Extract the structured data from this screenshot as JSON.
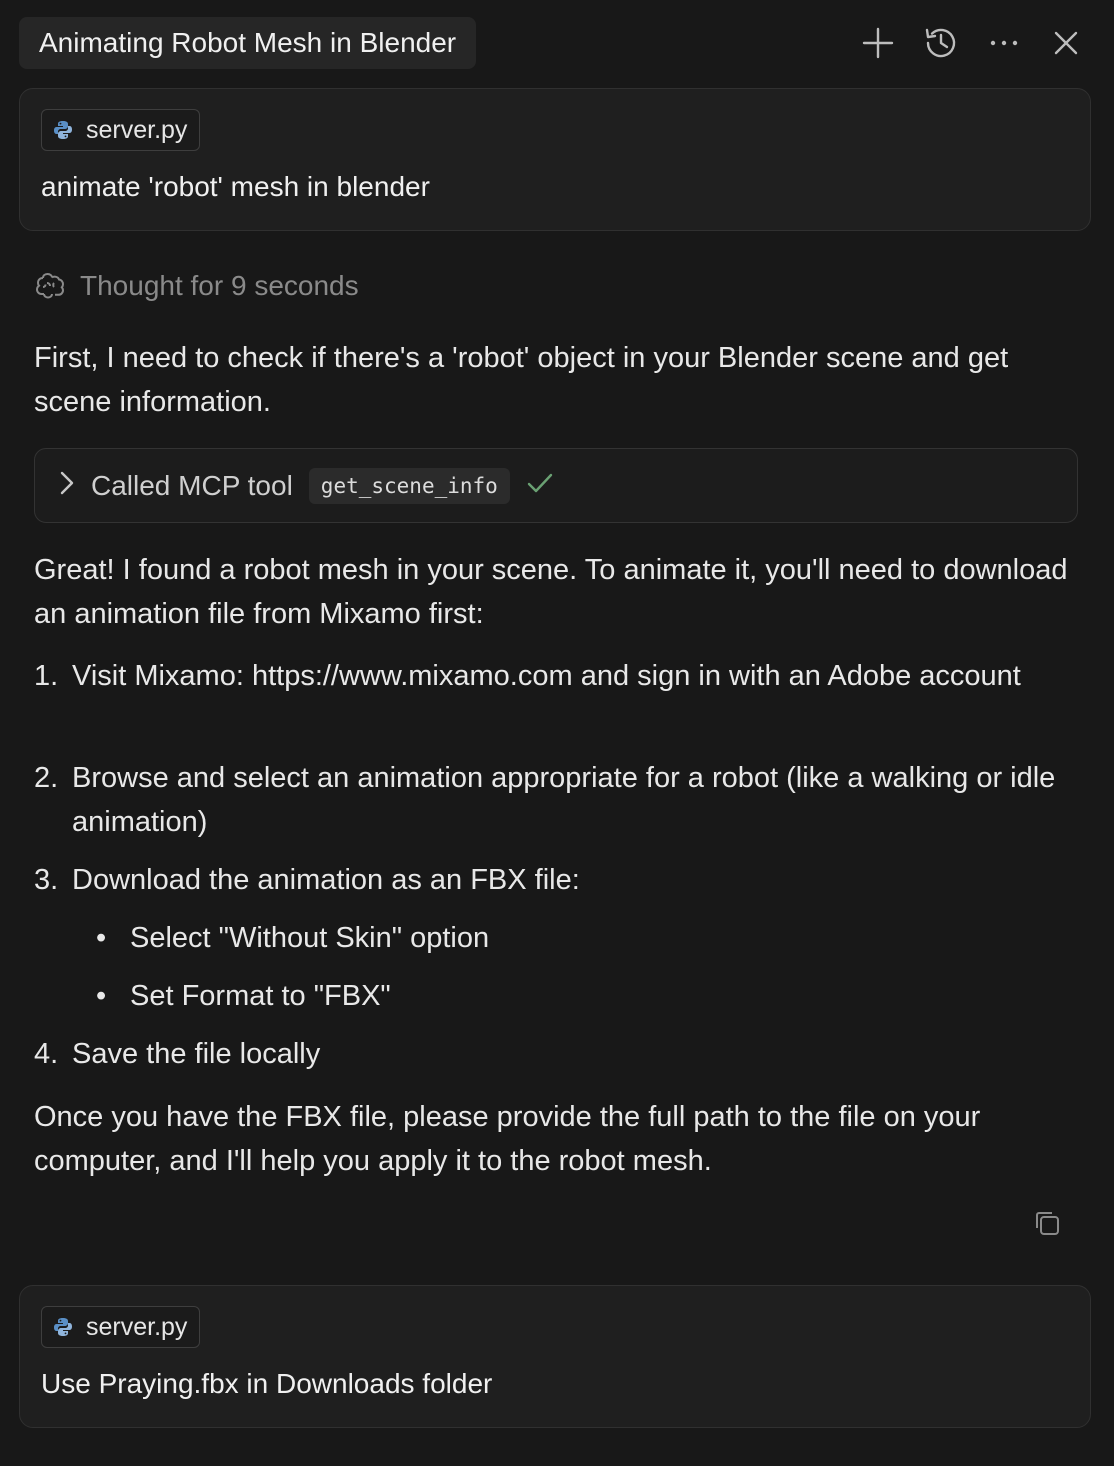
{
  "header": {
    "title": "Animating Robot Mesh in Blender",
    "buttons": [
      "plus-icon",
      "history-icon",
      "more-icon",
      "close-icon"
    ]
  },
  "messages": {
    "first_user": {
      "file_chip": "server.py",
      "text": "animate 'robot' mesh in blender"
    },
    "thought": "Thought for 9 seconds",
    "intro": "First, I need to check if there's a 'robot' object in your Blender scene and get scene information.",
    "tool_call": {
      "label": "Called MCP tool",
      "tool_name": "get_scene_info",
      "status_icon": "check-icon"
    },
    "found": "Great! I found a robot mesh in your scene. To animate it, you'll need to download an animation file from Mixamo first:",
    "steps": [
      {
        "num": "1.",
        "text": "Visit Mixamo: https://www.mixamo.com and sign in with an Adobe account"
      },
      {
        "num": "2.",
        "text": "Browse and select an animation appropriate for a robot (like a walking or idle animation)"
      },
      {
        "num": "3.",
        "text": "Download the animation as an FBX file:"
      },
      {
        "num": "4.",
        "text": "Save the file locally"
      }
    ],
    "substeps": [
      "Select \"Without Skin\" option",
      "Set Format to \"FBX\""
    ],
    "closing": "Once you have the FBX file, please provide the full path to the file on your computer, and I'll help you apply it to the robot mesh.",
    "second_user": {
      "file_chip": "server.py",
      "text": "Use Praying.fbx in Downloads folder"
    }
  },
  "colors": {
    "background": "#181818",
    "card": "#1f1f1f",
    "check": "#6aa173",
    "muted": "#8a8a8a"
  }
}
